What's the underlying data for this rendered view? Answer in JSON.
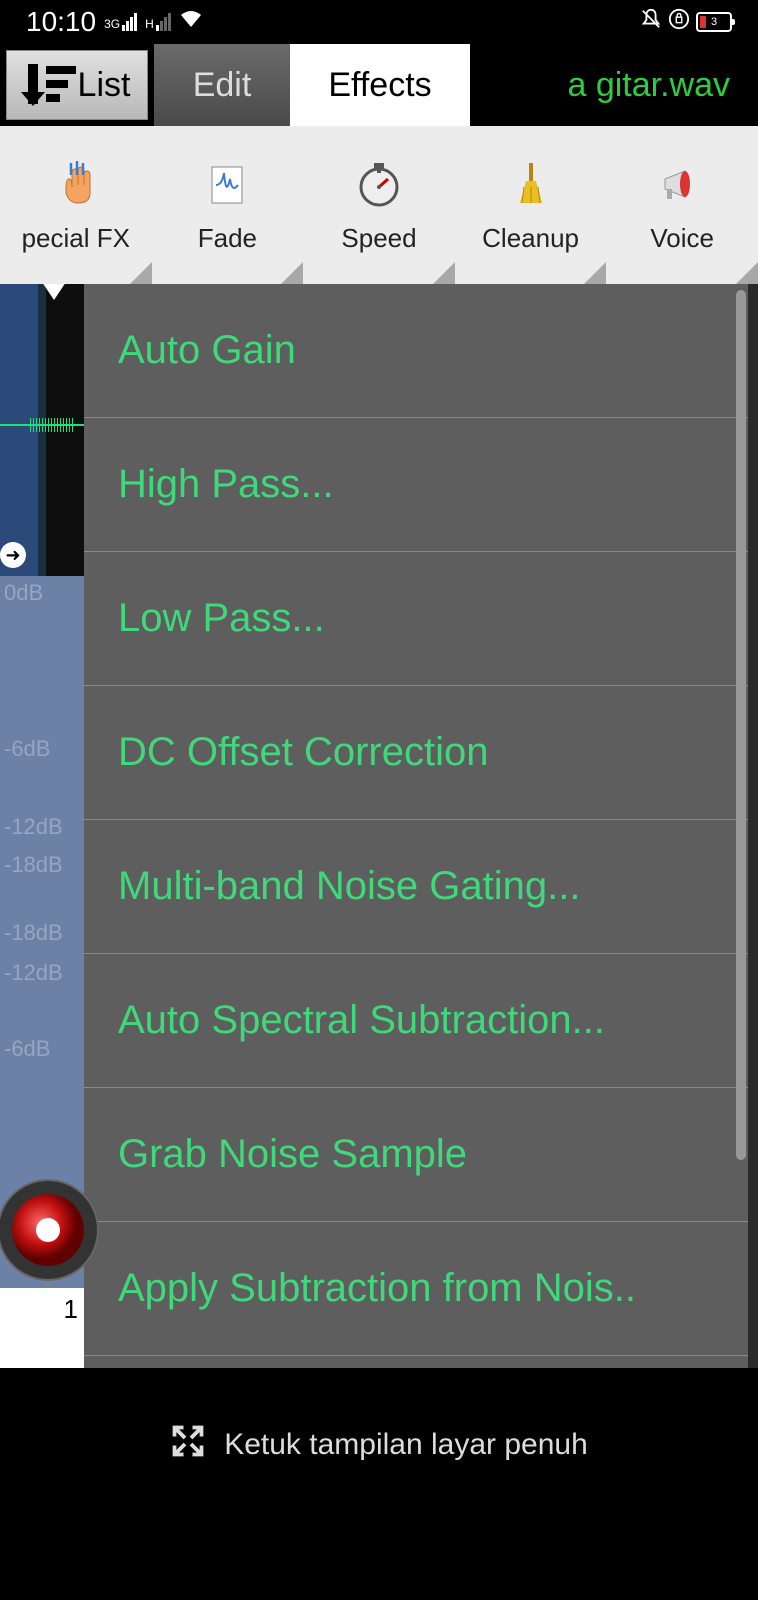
{
  "status": {
    "time": "10:10",
    "net1": "3G",
    "net2": "H",
    "battery": "3"
  },
  "tabs": {
    "list": "List",
    "edit": "Edit",
    "effects": "Effects"
  },
  "filename": "a gitar.wav",
  "toolbar": {
    "items": [
      {
        "label": "pecial FX"
      },
      {
        "label": "Fade"
      },
      {
        "label": "Speed"
      },
      {
        "label": "Cleanup"
      },
      {
        "label": "Voice"
      }
    ]
  },
  "db_labels": [
    "0dB",
    "-6dB",
    "-12dB",
    "-18dB",
    "-18dB",
    "-12dB",
    "-6dB"
  ],
  "timeline_marker": "1",
  "menu": {
    "items": [
      "Auto Gain",
      "High Pass...",
      "Low Pass...",
      "DC Offset Correction",
      "Multi-band Noise Gating...",
      "Auto Spectral Subtraction...",
      "Grab Noise Sample",
      "Apply Subtraction from Nois.."
    ]
  },
  "footer_hint": "Ketuk tampilan layar penuh"
}
